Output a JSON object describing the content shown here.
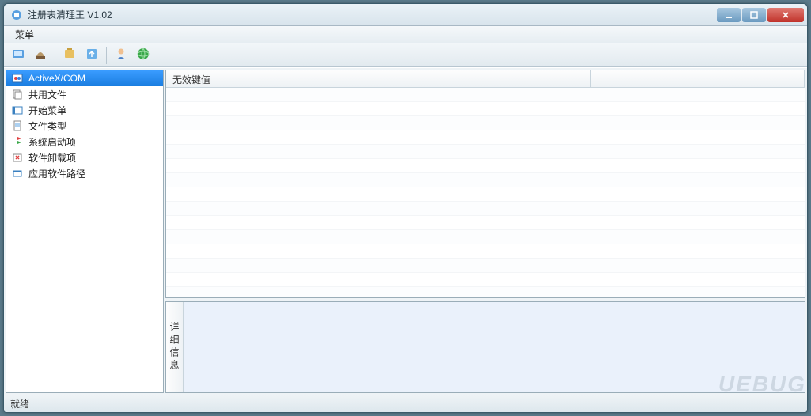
{
  "window": {
    "title": "注册表清理王 V1.02"
  },
  "menubar": {
    "items": [
      "菜单"
    ]
  },
  "toolbar": {
    "buttons": [
      {
        "name": "scan-icon"
      },
      {
        "name": "clean-icon"
      },
      {
        "name": "backup-icon"
      },
      {
        "name": "restore-icon"
      },
      {
        "name": "help-icon"
      },
      {
        "name": "about-icon"
      }
    ]
  },
  "sidebar": {
    "items": [
      {
        "label": "ActiveX/COM",
        "icon": "activex-icon",
        "selected": true
      },
      {
        "label": "共用文件",
        "icon": "shared-files-icon",
        "selected": false
      },
      {
        "label": "开始菜单",
        "icon": "start-menu-icon",
        "selected": false
      },
      {
        "label": "文件类型",
        "icon": "file-type-icon",
        "selected": false
      },
      {
        "label": "系统启动项",
        "icon": "startup-icon",
        "selected": false
      },
      {
        "label": "软件卸载项",
        "icon": "uninstall-icon",
        "selected": false
      },
      {
        "label": "应用软件路径",
        "icon": "app-path-icon",
        "selected": false
      }
    ]
  },
  "list": {
    "columns": [
      "无效键值",
      ""
    ],
    "rows": []
  },
  "detail": {
    "tab_label": "详细信息"
  },
  "statusbar": {
    "text": "就绪"
  },
  "watermark": "UEBUG"
}
